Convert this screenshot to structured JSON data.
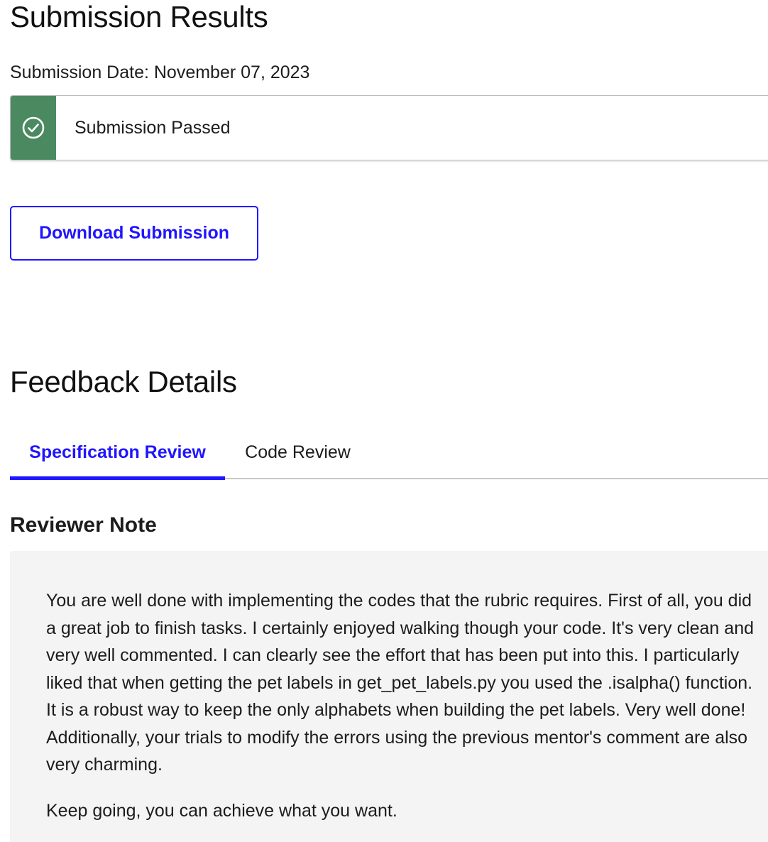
{
  "header": {
    "title": "Submission Results",
    "submission_date": "Submission Date: November 07, 2023"
  },
  "status": {
    "icon": "check-circle-icon",
    "text": "Submission Passed",
    "color": "#4b8a61"
  },
  "actions": {
    "download_label": "Download Submission"
  },
  "feedback": {
    "title": "Feedback Details",
    "tabs": [
      {
        "label": "Specification Review",
        "active": true
      },
      {
        "label": "Code Review",
        "active": false
      }
    ],
    "reviewer_note_title": "Reviewer Note",
    "note_paragraph": "You are well done with implementing the codes that the rubric requires. First of all, you did a great job to finish tasks. I certainly enjoyed walking though your code. It's very clean and very well commented. I can clearly see the effort that has been put into this. I particularly liked that when getting the pet labels in get_pet_labels.py you used the .isalpha() function. It is a robust way to keep the only alphabets when building the pet labels. Very well done! Additionally, your trials to modify the errors using the previous mentor's comment are also very charming.",
    "note_closing": "Keep going, you can achieve what you want."
  },
  "colors": {
    "accent": "#2015ff",
    "success": "#4b8a61",
    "note_background": "#f4f4f4"
  }
}
